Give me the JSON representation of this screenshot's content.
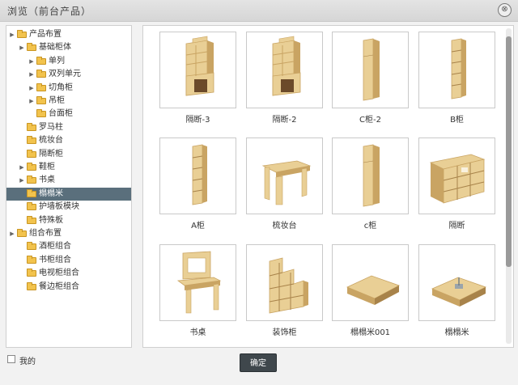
{
  "window": {
    "title": "浏览（前台产品）",
    "close_glyph": "⊗"
  },
  "tree": {
    "items": [
      {
        "label": "产品布置",
        "level": 0,
        "toggle": "▶"
      },
      {
        "label": "基础柜体",
        "level": 1,
        "toggle": "▶"
      },
      {
        "label": "单列",
        "level": 2,
        "toggle": "▶"
      },
      {
        "label": "双列单元",
        "level": 2,
        "toggle": "▶"
      },
      {
        "label": "切角柜",
        "level": 2,
        "toggle": "▶"
      },
      {
        "label": "吊柜",
        "level": 2,
        "toggle": "▶"
      },
      {
        "label": "台面柜",
        "level": 2,
        "toggle": ""
      },
      {
        "label": "罗马柱",
        "level": 1,
        "toggle": ""
      },
      {
        "label": "梳妆台",
        "level": 1,
        "toggle": ""
      },
      {
        "label": "隔断柜",
        "level": 1,
        "toggle": ""
      },
      {
        "label": "鞋柜",
        "level": 1,
        "toggle": "▶"
      },
      {
        "label": "书桌",
        "level": 1,
        "toggle": "▶"
      },
      {
        "label": "榻榻米",
        "level": 1,
        "toggle": "",
        "selected": true
      },
      {
        "label": "护墙板模块",
        "level": 1,
        "toggle": ""
      },
      {
        "label": "特殊板",
        "level": 1,
        "toggle": ""
      },
      {
        "label": "组合布置",
        "level": 0,
        "toggle": "▶"
      },
      {
        "label": "酒柜组合",
        "level": 1,
        "toggle": ""
      },
      {
        "label": "书柜组合",
        "level": 1,
        "toggle": ""
      },
      {
        "label": "电视柜组合",
        "level": 1,
        "toggle": ""
      },
      {
        "label": "餐边柜组合",
        "level": 1,
        "toggle": ""
      }
    ]
  },
  "products": [
    {
      "label": "隔断-3",
      "icon": "partition-shelf-icon"
    },
    {
      "label": "隔断-2",
      "icon": "partition-shelf-icon"
    },
    {
      "label": "C柜-2",
      "icon": "narrow-cabinet-icon"
    },
    {
      "label": "B柜",
      "icon": "narrow-shelf-icon"
    },
    {
      "label": "A柜",
      "icon": "narrow-shelf-icon"
    },
    {
      "label": "梳妆台",
      "icon": "dressing-table-icon"
    },
    {
      "label": "c柜",
      "icon": "narrow-cabinet-icon"
    },
    {
      "label": "隔断",
      "icon": "grid-partition-icon"
    },
    {
      "label": "书桌",
      "icon": "desk-hutch-icon"
    },
    {
      "label": "装饰柜",
      "icon": "stepped-cabinet-icon"
    },
    {
      "label": "榻榻米001",
      "icon": "tatami-platform-icon"
    },
    {
      "label": "榻榻米",
      "icon": "tatami-lift-icon"
    }
  ],
  "footer": {
    "checkbox_label": "我的",
    "ok_label": "确定"
  },
  "colors": {
    "wood": "#e9cf95",
    "wood_dark": "#c9a463",
    "wood_shadow": "#a8834a",
    "selected_row": "#5a6f7c",
    "ok_button": "#3f474c"
  }
}
